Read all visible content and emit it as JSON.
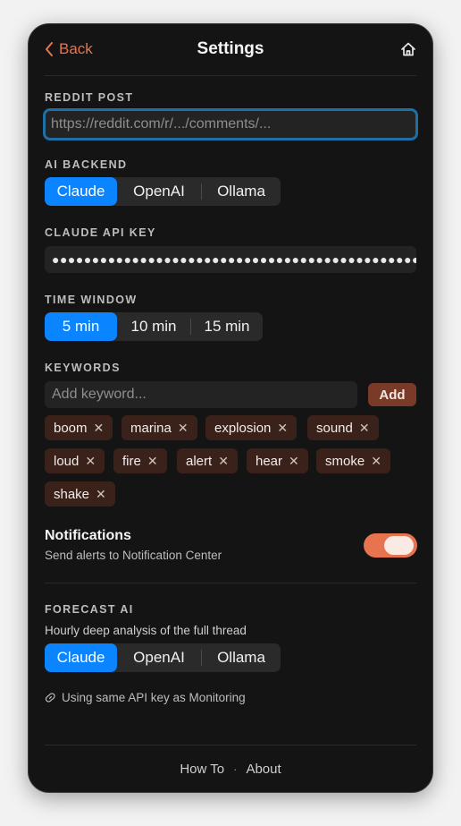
{
  "header": {
    "back_label": "Back",
    "title": "Settings"
  },
  "reddit_post": {
    "label": "REDDIT POST",
    "placeholder": "https://reddit.com/r/.../comments/...",
    "value": ""
  },
  "ai_backend": {
    "label": "AI BACKEND",
    "options": [
      "Claude",
      "OpenAI",
      "Ollama"
    ],
    "selected": "Claude"
  },
  "api_key": {
    "label": "CLAUDE API KEY",
    "masked_value": "●●●●●●●●●●●●●●●●●●●●●●●●●●●●●●●●●●●●●●●●●●●●●●●●●●●●●●"
  },
  "time_window": {
    "label": "TIME WINDOW",
    "options": [
      "5 min",
      "10 min",
      "15 min"
    ],
    "selected": "5 min"
  },
  "keywords": {
    "label": "KEYWORDS",
    "placeholder": "Add keyword...",
    "add_label": "Add",
    "chips": [
      "boom",
      "marina",
      "explosion",
      "sound",
      "loud",
      "fire",
      "alert",
      "hear",
      "smoke",
      "shake"
    ],
    "remove_glyph": "✕"
  },
  "notifications": {
    "title": "Notifications",
    "subtitle": "Send alerts to Notification Center",
    "enabled": true
  },
  "forecast": {
    "label": "FORECAST AI",
    "subtitle": "Hourly deep analysis of the full thread",
    "options": [
      "Claude",
      "OpenAI",
      "Ollama"
    ],
    "selected": "Claude",
    "note": "Using same API key as Monitoring"
  },
  "footer": {
    "how_to": "How To",
    "separator": "·",
    "about": "About"
  },
  "colors": {
    "accent": "#e8734f",
    "selected_segment": "#0a84ff",
    "chip_bg": "#3a221b",
    "input_focus": "#1d6fa5"
  }
}
